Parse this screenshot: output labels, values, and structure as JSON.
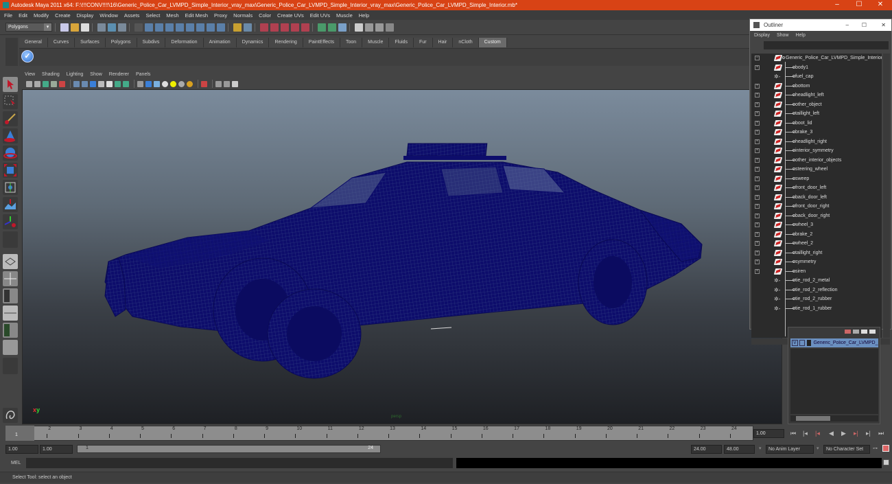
{
  "window": {
    "title": "Autodesk Maya 2011 x64: F:\\!!!CONV!!!!\\16\\Generic_Police_Car_LVMPD_Simple_Interior_vray_max\\Generic_Police_Car_LVMPD_Simple_Interior_vray_max\\Generic_Police_Car_LVMPD_Simple_Interior.mb*",
    "controls": {
      "minimize": "–",
      "maximize": "☐",
      "close": "✕"
    },
    "accent": "#d84315"
  },
  "menubar": [
    "File",
    "Edit",
    "Modify",
    "Create",
    "Display",
    "Window",
    "Assets",
    "Select",
    "Mesh",
    "Edit Mesh",
    "Proxy",
    "Normals",
    "Color",
    "Create UVs",
    "Edit UVs",
    "Muscle",
    "Help"
  ],
  "toolbar": {
    "mode_selector": "Polygons"
  },
  "shelf": {
    "tabs": [
      "General",
      "Curves",
      "Surfaces",
      "Polygons",
      "Subdivs",
      "Deformation",
      "Animation",
      "Dynamics",
      "Rendering",
      "PaintEffects",
      "Toon",
      "Muscle",
      "Fluids",
      "Fur",
      "Hair",
      "nCloth",
      "Custom"
    ],
    "active_tab": "Custom",
    "items": [
      {
        "icon": "checkmark-icon"
      }
    ]
  },
  "viewport": {
    "menu": [
      "View",
      "Shading",
      "Lighting",
      "Show",
      "Renderer",
      "Panels"
    ],
    "camera_label": "persp",
    "axis": {
      "x": "x",
      "y": "y"
    },
    "wireframe_color": "#0d0d6b"
  },
  "timeline": {
    "ticks": [
      "1",
      "2",
      "3",
      "4",
      "5",
      "6",
      "7",
      "8",
      "9",
      "10",
      "11",
      "12",
      "13",
      "14",
      "15",
      "16",
      "17",
      "18",
      "19",
      "20",
      "21",
      "22",
      "23",
      "24"
    ],
    "current_frame": "1",
    "current_time": "1.00"
  },
  "range": {
    "start_time": "1.00",
    "playback_start": "1.00",
    "range_start_label": "1",
    "range_end_label": "24",
    "playback_end": "24.00",
    "end_time": "48.00",
    "anim_layer": "No Anim Layer",
    "character_set": "No Character Set"
  },
  "command_line": {
    "label": "MEL",
    "value": ""
  },
  "status": "Select Tool: select an object",
  "outliner": {
    "title": "Outliner",
    "menu": [
      "Display",
      "Show",
      "Help"
    ],
    "root": "Generic_Police_Car_LVMPD_Simple_Interior",
    "items": [
      {
        "name": "body1",
        "type": "mesh",
        "expandable": true
      },
      {
        "name": "fuel_cap",
        "type": "shape",
        "expandable": false
      },
      {
        "name": "bottom",
        "type": "mesh",
        "expandable": true
      },
      {
        "name": "headlight_left",
        "type": "mesh",
        "expandable": true
      },
      {
        "name": "other_object",
        "type": "mesh",
        "expandable": true
      },
      {
        "name": "taillight_left",
        "type": "mesh",
        "expandable": true
      },
      {
        "name": "boot_lid",
        "type": "mesh",
        "expandable": true
      },
      {
        "name": "brake_3",
        "type": "mesh",
        "expandable": true
      },
      {
        "name": "headlight_right",
        "type": "mesh",
        "expandable": true
      },
      {
        "name": "interior_symmetry",
        "type": "mesh",
        "expandable": true
      },
      {
        "name": "other_interior_objects",
        "type": "mesh",
        "expandable": true
      },
      {
        "name": "steering_wheel",
        "type": "mesh",
        "expandable": true
      },
      {
        "name": "sweep",
        "type": "mesh",
        "expandable": true
      },
      {
        "name": "front_door_left",
        "type": "mesh",
        "expandable": true
      },
      {
        "name": "back_door_left",
        "type": "mesh",
        "expandable": true
      },
      {
        "name": "front_door_right",
        "type": "mesh",
        "expandable": true
      },
      {
        "name": "back_door_right",
        "type": "mesh",
        "expandable": true
      },
      {
        "name": "wheel_3",
        "type": "mesh",
        "expandable": true
      },
      {
        "name": "brake_2",
        "type": "mesh",
        "expandable": true
      },
      {
        "name": "wheel_2",
        "type": "mesh",
        "expandable": true
      },
      {
        "name": "taillight_right",
        "type": "mesh",
        "expandable": true
      },
      {
        "name": "symmetry",
        "type": "mesh",
        "expandable": true
      },
      {
        "name": "siren",
        "type": "mesh",
        "expandable": true
      },
      {
        "name": "tie_rod_2_metal",
        "type": "shape",
        "expandable": false
      },
      {
        "name": "tie_rod_2_reflection",
        "type": "shape",
        "expandable": false
      },
      {
        "name": "tie_rod_2_rubber",
        "type": "shape",
        "expandable": false
      },
      {
        "name": "tie_rod_1_rubber",
        "type": "shape",
        "expandable": false
      }
    ]
  },
  "layers": {
    "items": [
      {
        "visible": "V",
        "name": "Generic_Police_Car_LVMPD_Simple_Interior"
      }
    ]
  }
}
